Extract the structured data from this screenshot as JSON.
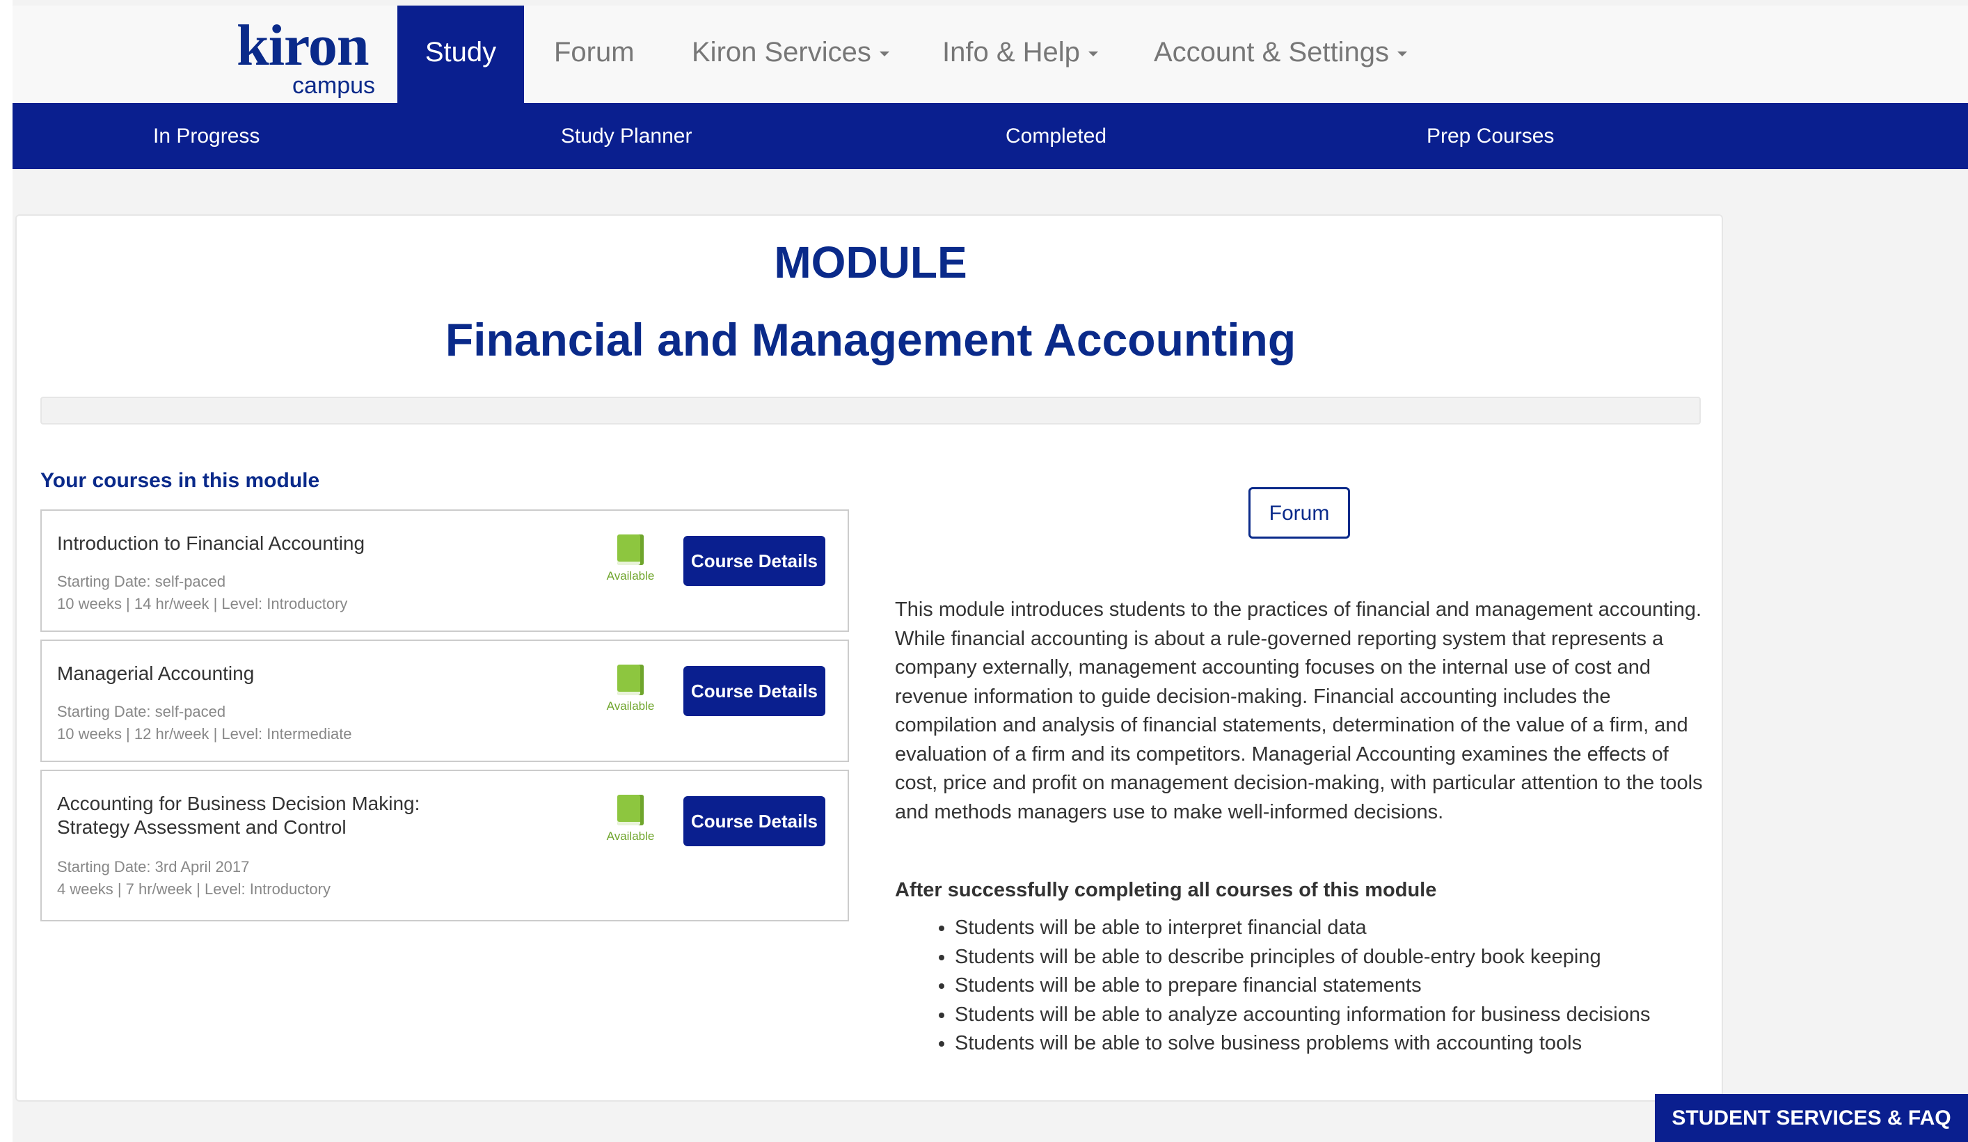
{
  "brand": {
    "name": "kiron",
    "sub": "campus"
  },
  "nav": {
    "items": [
      {
        "label": "Study"
      },
      {
        "label": "Forum"
      },
      {
        "label": "Kiron Services"
      },
      {
        "label": "Info & Help"
      },
      {
        "label": "Account & Settings"
      }
    ]
  },
  "subnav": {
    "items": [
      {
        "label": "In Progress"
      },
      {
        "label": "Study Planner"
      },
      {
        "label": "Completed"
      },
      {
        "label": "Prep Courses"
      }
    ]
  },
  "module": {
    "label": "MODULE",
    "title": "Financial and Management Accounting",
    "progress": 0
  },
  "courses": {
    "heading": "Your courses in this module",
    "items": [
      {
        "title": "Introduction to Financial Accounting",
        "start": "Starting Date: self-paced",
        "details": "10 weeks | 14 hr/week | Level: Introductory",
        "status": "Available",
        "button": "Course Details"
      },
      {
        "title": "Managerial Accounting",
        "start": "Starting Date: self-paced",
        "details": "10 weeks | 12 hr/week | Level: Intermediate",
        "status": "Available",
        "button": "Course Details"
      },
      {
        "title": "Accounting for Business Decision Making: Strategy Assessment and Control",
        "start": "Starting Date: 3rd April 2017",
        "details": "4 weeks | 7 hr/week | Level: Introductory",
        "status": "Available",
        "button": "Course Details"
      }
    ]
  },
  "forum_button": "Forum",
  "description": "This module introduces students to the practices of financial and management accounting. While financial accounting is about a rule-governed reporting system that represents a company externally, management accounting focuses on the internal use of cost and revenue information to guide decision-making. Financial accounting includes the compilation and analysis of financial statements, determination of the value of a firm, and evaluation of a firm and its competitors. Managerial Accounting examines the effects of cost, price and profit on management decision-making, with particular attention to the tools and methods managers use to make well-informed decisions.",
  "outcomes": {
    "heading": "After successfully completing all courses of this module",
    "items": [
      "Students will be able to interpret financial data",
      "Students will be able to describe principles of double-entry book keeping",
      "Students will be able to prepare financial statements",
      "Students will be able to analyze accounting information for business decisions",
      "Students will be able to solve business problems with accounting tools"
    ]
  },
  "faq_button": "STUDENT SERVICES & FAQ",
  "colors": {
    "brand": "#0a1f8f",
    "available": "#8dc63f"
  }
}
